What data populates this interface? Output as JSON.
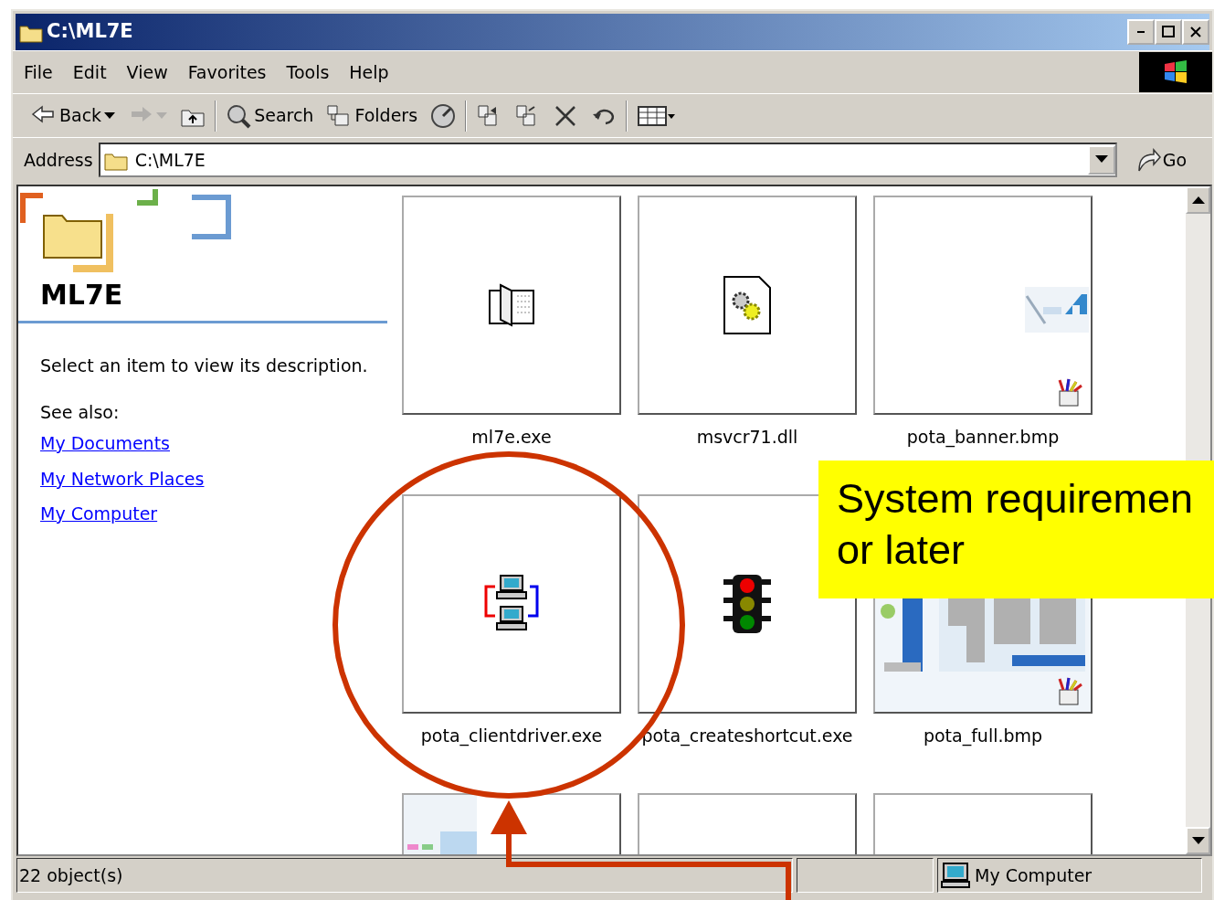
{
  "window": {
    "title": "C:\\ML7E"
  },
  "menu": [
    {
      "label": "File"
    },
    {
      "label": "Edit"
    },
    {
      "label": "View"
    },
    {
      "label": "Favorites"
    },
    {
      "label": "Tools"
    },
    {
      "label": "Help"
    }
  ],
  "toolbar": [
    {
      "kind": "back",
      "label": "Back",
      "disabled": false
    },
    {
      "kind": "forward",
      "disabled": true
    },
    {
      "kind": "up"
    },
    {
      "kind": "sep"
    },
    {
      "kind": "search",
      "label": "Search"
    },
    {
      "kind": "folders",
      "label": "Folders"
    },
    {
      "kind": "history"
    },
    {
      "kind": "sep"
    },
    {
      "kind": "moveto"
    },
    {
      "kind": "copyto"
    },
    {
      "kind": "delete"
    },
    {
      "kind": "undo"
    },
    {
      "kind": "sep"
    },
    {
      "kind": "views"
    }
  ],
  "address": {
    "label": "Address",
    "value": "C:\\ML7E",
    "go": "Go"
  },
  "sidebar": {
    "title": "ML7E",
    "description": "Select an item to view its description.",
    "see_also": "See also:",
    "links": [
      {
        "label": "My Documents"
      },
      {
        "label": "My Network Places"
      },
      {
        "label": "My Computer"
      }
    ]
  },
  "files": [
    {
      "name": "ml7e.exe",
      "kind": "book"
    },
    {
      "name": "msvcr71.dll",
      "kind": "dll"
    },
    {
      "name": "pota_banner.bmp",
      "kind": "banner"
    },
    {
      "name": "pota_clientdriver.exe",
      "kind": "network"
    },
    {
      "name": "pota_createshortcut.exe",
      "kind": "traffic"
    },
    {
      "name": "pota_full.bmp",
      "kind": "full"
    },
    {
      "kind": "thumb"
    },
    {
      "kind": "blank"
    },
    {
      "kind": "blank"
    }
  ],
  "status_bar": {
    "count": "22 object(s)",
    "zone": "My Computer"
  },
  "callout": {
    "lines": [
      "System requiremen",
      "or later"
    ]
  }
}
